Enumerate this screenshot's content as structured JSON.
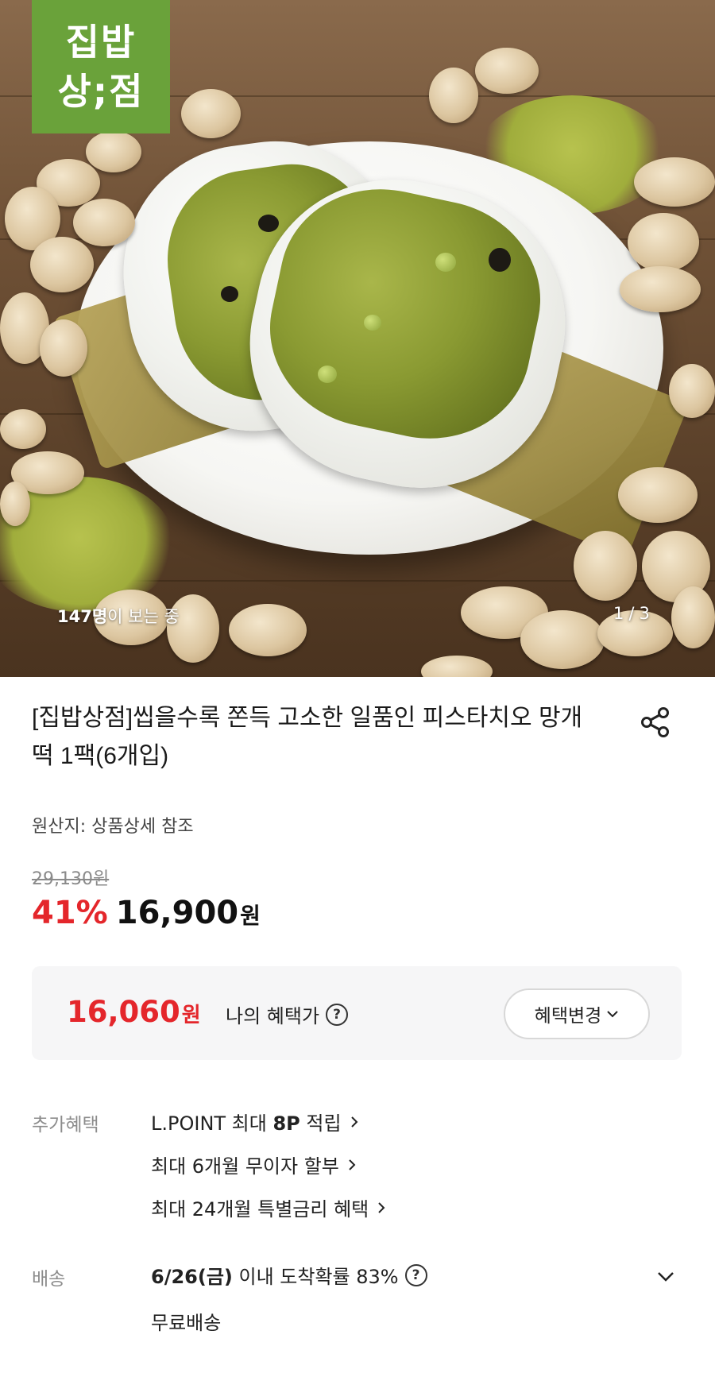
{
  "hero": {
    "logo_line1": "집밥",
    "logo_line2": "상;점",
    "viewers_count": "147명",
    "viewers_suffix": "이 보는 중",
    "image_index": "1",
    "image_separator": "/",
    "image_total": "3"
  },
  "product": {
    "title": "[집밥상점]씹을수록 쫀득 고소한 일품인 피스타치오 망개떡 1팩(6개입)",
    "origin": "원산지: 상품상세 참조",
    "original_price": "29,130원",
    "discount": "41%",
    "price": "16,900",
    "price_unit": "원"
  },
  "benefit": {
    "price": "16,060",
    "price_unit": "원",
    "label": "나의 혜택가",
    "help": "?",
    "button_label": "혜택변경"
  },
  "extra_benefits": {
    "label": "추가혜택",
    "items": [
      {
        "prefix": "L.POINT 최대 ",
        "bold": "8P",
        "suffix": " 적립"
      },
      {
        "prefix": "최대 6개월 무이자 할부",
        "bold": "",
        "suffix": ""
      },
      {
        "prefix": "최대 24개월 특별금리 혜택",
        "bold": "",
        "suffix": ""
      }
    ]
  },
  "delivery": {
    "label": "배송",
    "date": "6/26(금)",
    "text": " 이내 도착확률 83%",
    "help": "?",
    "fee": "무료배송"
  },
  "colors": {
    "discount_red": "#e4262b",
    "logo_green": "#6aa23a"
  },
  "icons": [
    "share-icon",
    "help-icon",
    "chevron-down-icon",
    "chevron-right-icon"
  ]
}
